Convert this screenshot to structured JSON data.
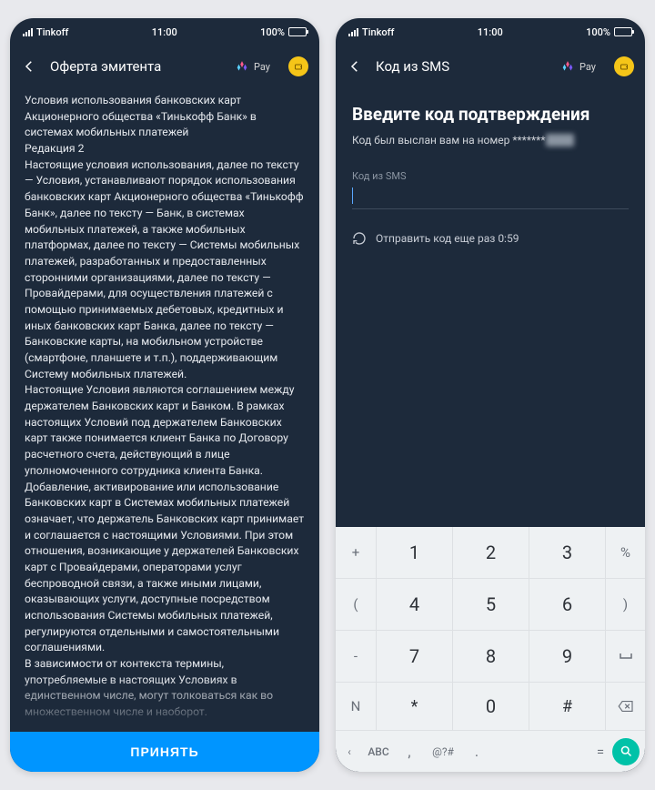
{
  "status": {
    "carrier": "Tinkoff",
    "time": "11:00",
    "battery": "100%"
  },
  "pay_label": "Pay",
  "left": {
    "appbar_title": "Оферта эмитента",
    "terms_p1": "Условия использования банковских карт Акционерного общества «Тинькофф Банк» в системах мобильных платежей",
    "terms_edition": "Редакция 2",
    "terms_p2": "Настоящие условия использования, далее по тексту — Условия, устанавливают порядок использования банковских карт Акционерного общества «Тинькофф Банк», далее по тексту — Банк, в системах мобильных платежей, а также мобильных платформах, далее по тексту — Системы мобильных платежей, разработанных и предоставленных сторонними организациями, далее по тексту — Провайдерами, для осуществления платежей с помощью принимаемых дебетовых, кредитных и иных банковских карт Банка, далее по тексту — Банковские карты, на мобильном устройстве (смартфоне, планшете и т.п.), поддерживающим Систему мобильных платежей.",
    "terms_p3": "Настоящие Условия являются соглашением между держателем Банковских карт и Банком. В рамках настоящих Условий под держателем Банковских карт также понимается клиент Банка по Договору расчетного счета, действующий в лице уполномоченного сотрудника клиента Банка. Добавление, активирование или использование Банковских карт в Системах мобильных платежей означает, что держатель Банковских карт принимает и соглашается с настоящими Условиями. При этом отношения, возникающие у держателей Банковских карт с Провайдерами, операторами услуг беспроводной связи, а также иными лицами, оказывающих услуги, доступные посредством использования Системы мобильных платежей, регулируются отдельными и самостоятельными соглашениями.",
    "terms_p4": "В зависимости от контекста термины, употребляемые в настоящих Условиях в единственном числе, могут толковаться как во множественном числе и наоборот.",
    "accept": "ПРИНЯТЬ"
  },
  "right": {
    "appbar_title": "Код из SMS",
    "heading": "Введите код подтверждения",
    "sent_prefix": "Код был выслан вам на номер ",
    "sent_mask": "*******",
    "input_label": "Код из SMS",
    "resend": "Отправить код еще раз 0:59"
  },
  "keyboard": {
    "side_left": [
      "+",
      "(",
      "-",
      "N"
    ],
    "side_right": [
      "%",
      ")",
      " ",
      " "
    ],
    "main": [
      {
        "n": "1",
        "s": ""
      },
      {
        "n": "2",
        "s": ""
      },
      {
        "n": "3",
        "s": ""
      },
      {
        "n": "4",
        "s": ""
      },
      {
        "n": "5",
        "s": ""
      },
      {
        "n": "6",
        "s": ""
      },
      {
        "n": "7",
        "s": ""
      },
      {
        "n": "8",
        "s": ""
      },
      {
        "n": "9",
        "s": ""
      },
      {
        "n": "*",
        "s": ""
      },
      {
        "n": "0",
        "s": ""
      },
      {
        "n": "#",
        "s": ""
      }
    ],
    "bottom": {
      "abc": "ABC",
      "comma": ",",
      "sym": "@?#",
      "dot": ".",
      "eq": "="
    }
  }
}
